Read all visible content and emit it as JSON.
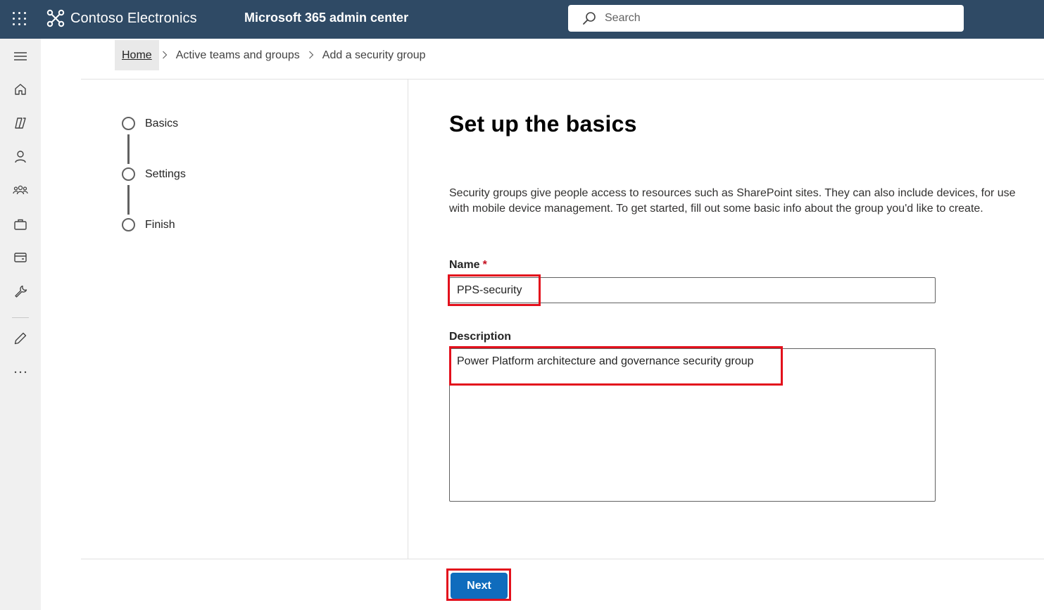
{
  "topbar": {
    "brand_name": "Contoso Electronics",
    "app_title": "Microsoft 365 admin center",
    "search_placeholder": "Search",
    "background_color": "#2f4a65"
  },
  "rail": {
    "items": [
      {
        "icon": "menu-icon"
      },
      {
        "icon": "home-icon"
      },
      {
        "icon": "copilot-icon"
      },
      {
        "icon": "user-icon"
      },
      {
        "icon": "teams-groups-icon"
      },
      {
        "icon": "briefcase-icon"
      },
      {
        "icon": "billing-card-icon"
      },
      {
        "icon": "wrench-icon"
      },
      {
        "icon": "pencil-icon"
      },
      {
        "icon": "more-icon"
      }
    ]
  },
  "breadcrumb": {
    "items": [
      "Home",
      "Active teams and groups",
      "Add a security group"
    ],
    "separator": ">"
  },
  "wizard": {
    "steps": [
      "Basics",
      "Settings",
      "Finish"
    ]
  },
  "main": {
    "heading": "Set up the basics",
    "intro": "Security groups give people access to resources such as SharePoint sites. They can also include devices, for use with mobile device management. To get started, fill out some basic info about the group you'd like to create.",
    "name_label": "Name",
    "required_marker": "*",
    "name_value": "PPS-security",
    "description_label": "Description",
    "description_value": "Power Platform architecture and governance security group",
    "highlight_color": "#e3101c"
  },
  "footer": {
    "next_label": "Next",
    "next_color": "#0f6cbd"
  }
}
